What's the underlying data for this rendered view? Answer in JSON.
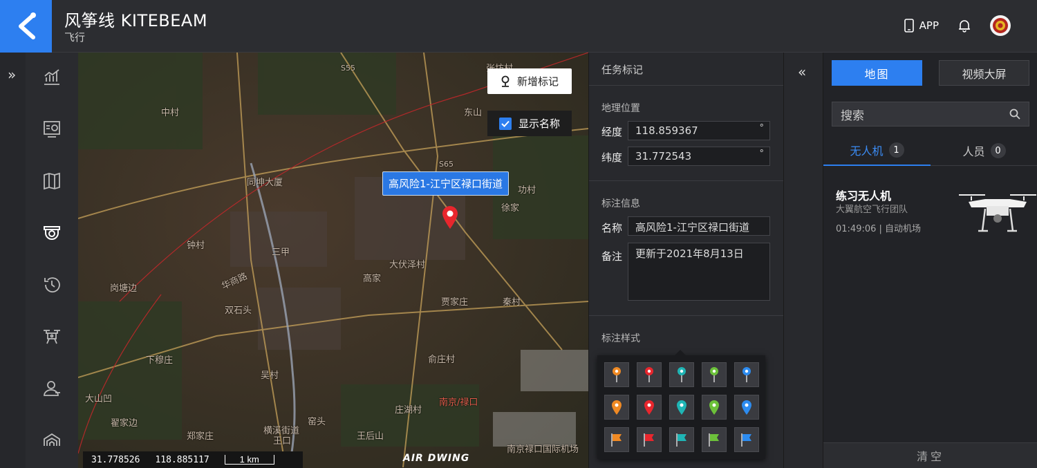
{
  "header": {
    "title": "风筝线 KITEBEAM",
    "subtitle": "飞行",
    "app_label": "APP"
  },
  "sidebar": {
    "items": [
      {
        "icon": "chart-icon"
      },
      {
        "icon": "monitor-icon"
      },
      {
        "icon": "map-icon"
      },
      {
        "icon": "camera-icon",
        "active": true
      },
      {
        "icon": "history-icon"
      },
      {
        "icon": "drone-icon"
      },
      {
        "icon": "person-icon"
      },
      {
        "icon": "hangar-icon"
      }
    ]
  },
  "map": {
    "add_marker_label": "新增标记",
    "show_names_label": "显示名称",
    "show_names_checked": true,
    "marker_callout": "高风险1-江宁区禄口街道",
    "cursor_lat": "31.778526",
    "cursor_lng": "118.885117",
    "scale_label": "1 km",
    "watermark": "AIR DWING",
    "place_labels": [
      "中村",
      "同坤大厦",
      "钟村",
      "三甲",
      "岗塘边",
      "双石头",
      "华商路",
      "下穆庄",
      "吴村",
      "大山凹",
      "翟家边",
      "郑家庄",
      "横溪街道",
      "王口",
      "窑头",
      "王后山",
      "庄湖村",
      "俞庄村",
      "南京/禄口",
      "南京禄口国际机场",
      "贾家庄",
      "秦村",
      "高家",
      "大伏泽村",
      "徐家",
      "功村",
      "东山",
      "张坊村",
      "S55",
      "S65",
      "华商路"
    ]
  },
  "panel": {
    "title": "任务标记",
    "geo_section": "地理位置",
    "lng_label": "经度",
    "lng_value": "118.859367",
    "lat_label": "纬度",
    "lat_value": "31.772543",
    "degree_unit": "°",
    "info_section": "标注信息",
    "name_label": "名称",
    "name_value": "高风险1-江宁区禄口街道",
    "note_label": "备注",
    "note_value": "更新于2021年8月13日",
    "style_section": "标注样式",
    "style_colors": [
      "#f08a24",
      "#e8262d",
      "#1fb5b5",
      "#6cc13a",
      "#2d8cf0"
    ]
  },
  "right": {
    "map_btn": "地图",
    "video_btn": "视频大屏",
    "search_placeholder": "搜索",
    "tab_drone": "无人机",
    "tab_drone_count": "1",
    "tab_person": "人员",
    "tab_person_count": "0",
    "drone": {
      "name": "练习无人机",
      "team": "大翼航空飞行团队",
      "meta": "01:49:06 | 自动机场"
    },
    "clear_btn": "清空"
  }
}
